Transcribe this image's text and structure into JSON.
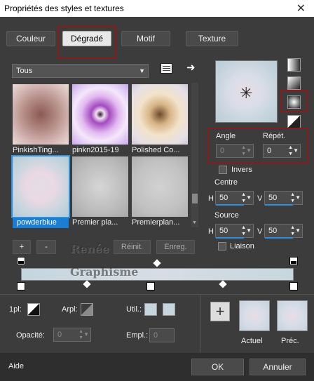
{
  "window": {
    "title": "Propriétés des styles et textures",
    "close": "✕"
  },
  "tabs": [
    {
      "label": "Couleur"
    },
    {
      "label": "Dégradé"
    },
    {
      "label": "Motif"
    },
    {
      "label": "Texture"
    }
  ],
  "category": {
    "value": "Tous"
  },
  "thumbnails": [
    {
      "label": "PinkishTing..."
    },
    {
      "label": "pinkn2015-19"
    },
    {
      "label": "Polished Co..."
    },
    {
      "label": "powderblue"
    },
    {
      "label": "Premier pla..."
    },
    {
      "label": "Premierplan..."
    }
  ],
  "buttons": {
    "plus": "+",
    "minus": "-",
    "reinit": "Réinit.",
    "enreg": "Enreg.",
    "ok": "OK",
    "annuler": "Annuler",
    "add": "+"
  },
  "settings": {
    "angle_label": "Angle",
    "angle_value": "0",
    "repet_label": "Répét.",
    "repet_value": "0",
    "invers_label": "Invers",
    "centre_label": "Centre",
    "centre_h_label": "H",
    "centre_h": "50",
    "centre_v_label": "V",
    "centre_v": "50",
    "source_label": "Source",
    "source_h_label": "H",
    "source_h": "50",
    "source_v_label": "V",
    "source_v": "50",
    "liaison_label": "Liaison"
  },
  "bottom": {
    "lpl_label": "1pl:",
    "arpl_label": "Arpl:",
    "util_label": "Util.:",
    "opacite_label": "Opacité:",
    "opacite_value": "0",
    "empl_label": "Empl.:",
    "empl_value": "0",
    "actuel_label": "Actuel",
    "prec_label": "Préc."
  },
  "footer": {
    "aide": "Aide"
  },
  "watermark": {
    "line1": "Renée",
    "line2": "Graphisme"
  },
  "colors": {
    "accent": "#2a8fe0",
    "highlight_box": "#8b1a1a",
    "gradient_swatch": "#c5d6de"
  }
}
